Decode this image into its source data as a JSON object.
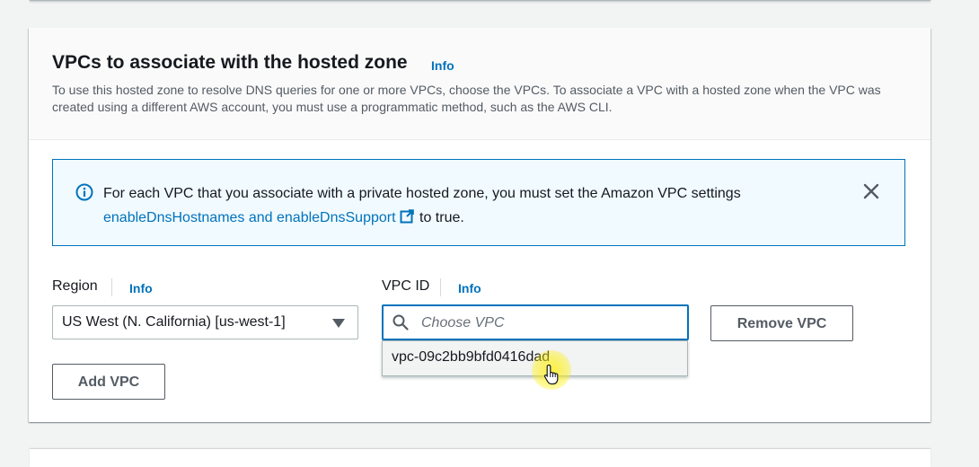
{
  "section": {
    "title": "VPCs to associate with the hosted zone",
    "info_label": "Info",
    "description": "To use this hosted zone to resolve DNS queries for one or more VPCs, choose the VPCs. To associate a VPC with a hosted zone when the VPC was created using a different AWS account, you must use a programmatic method, such as the AWS CLI."
  },
  "alert": {
    "text_before": "For each VPC that you associate with a private hosted zone, you must set the Amazon VPC settings",
    "link_text": "enableDnsHostnames and enableDnsSupport",
    "text_after": "to true.",
    "icon": "info-circle-icon",
    "close_icon": "close-icon"
  },
  "region": {
    "label": "Region",
    "info_label": "Info",
    "selected_value": "US West (N. California) [us-west-1]"
  },
  "vpc": {
    "label": "VPC ID",
    "info_label": "Info",
    "placeholder": "Choose VPC",
    "value": "",
    "options": [
      "vpc-09c2bb9bfd0416dad"
    ]
  },
  "buttons": {
    "remove_vpc": "Remove VPC",
    "add_vpc": "Add VPC"
  },
  "colors": {
    "link": "#0073bb",
    "alert_background": "#f1faff",
    "alert_border": "#0073bb",
    "page_background": "#f2f3f3"
  }
}
